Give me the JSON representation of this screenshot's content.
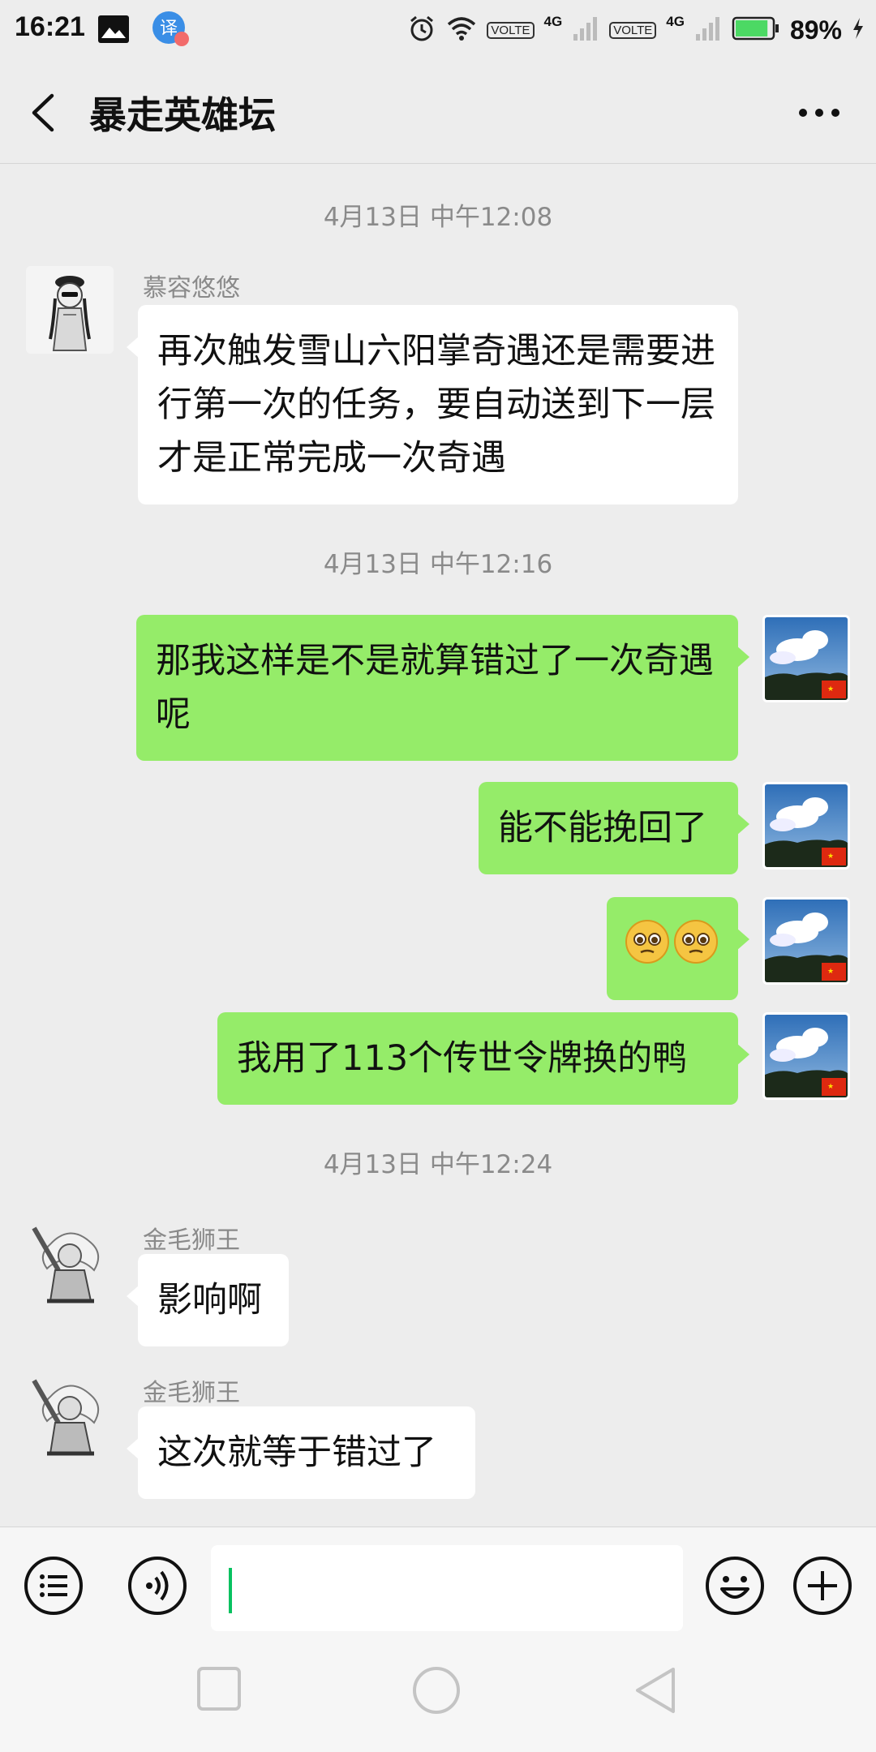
{
  "status_bar": {
    "time": "16:21",
    "volte_1": "VOLTE",
    "net_1": "4G",
    "volte_2": "VOLTE",
    "net_2": "4G",
    "battery_percent": "89%",
    "battery_level": 0.89,
    "icons": [
      "gallery-icon",
      "translate-icon",
      "alarm-icon",
      "wifi-icon",
      "signal-icon",
      "battery-icon",
      "charging-icon"
    ]
  },
  "nav": {
    "title": "暴走英雄坛",
    "back_icon": "chevron-left-icon",
    "more_icon": "more-icon"
  },
  "messages": {
    "ts1": "4月13日 中午12:08",
    "m1_sender": "慕容悠悠",
    "m1_text": "再次触发雪山六阳掌奇遇还是需要进行第一次的任务，要自动送到下一层才是正常完成一次奇遇",
    "ts2": "4月13日 中午12:16",
    "m2_text": "那我这样是不是就算错过了一次奇遇呢",
    "m3_text": "能不能挽回了",
    "m4_emoji": "🥺🥺",
    "m5_text": "我用了113个传世令牌换的鸭",
    "ts3": "4月13日 中午12:24",
    "m6_sender": "金毛狮王",
    "m6_text": "影响啊",
    "m7_sender": "金毛狮王",
    "m7_text": "这次就等于错过了"
  },
  "input_bar": {
    "icons": [
      "menu-list-icon",
      "voice-icon",
      "emoji-icon",
      "add-icon"
    ],
    "value": ""
  },
  "colors": {
    "background": "#ededed",
    "outgoing_bubble": "#95ec69",
    "incoming_bubble": "#ffffff",
    "timestamp": "#8a8a8a",
    "caret": "#07c160",
    "battery": "#4cd964"
  }
}
